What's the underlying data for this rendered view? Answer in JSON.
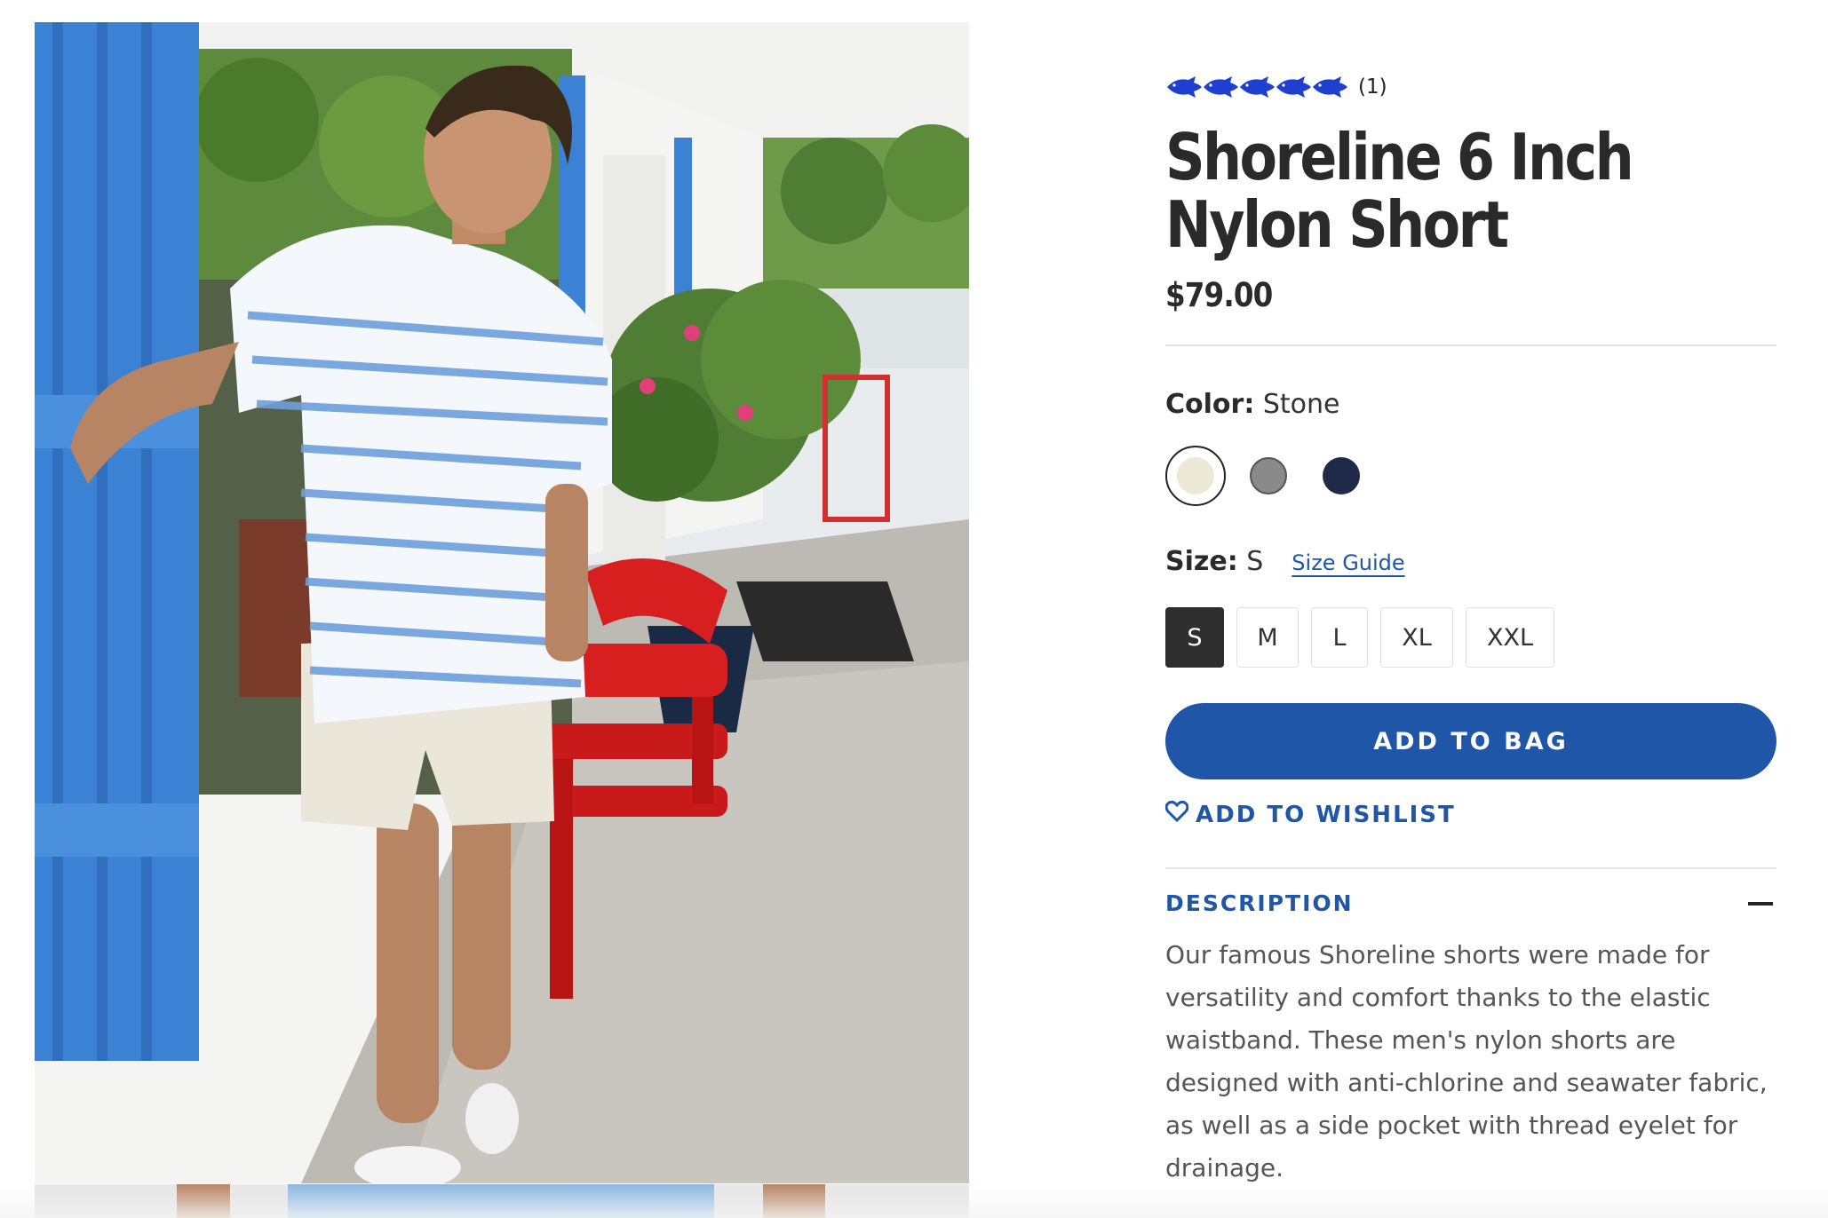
{
  "product": {
    "image_alt": "Man in striped button-down shirt and stone shorts leaning on blue shutter",
    "review_count": "(1)",
    "rating_icon": "fish-icon",
    "rating_color": "#1f3fd1",
    "title": "Shoreline 6 Inch Nylon Short",
    "price": "$79.00"
  },
  "color": {
    "label": "Color:",
    "selected": "Stone",
    "swatches": [
      {
        "name": "Stone",
        "hex": "#ece9d7"
      },
      {
        "name": "Gray",
        "hex": "#8a8a8a"
      },
      {
        "name": "Navy",
        "hex": "#1f2a4b"
      }
    ]
  },
  "size": {
    "label": "Size:",
    "selected": "S",
    "guide_link": "Size Guide",
    "options": [
      "S",
      "M",
      "L",
      "XL",
      "XXL"
    ]
  },
  "actions": {
    "add_to_bag": "ADD TO BAG",
    "add_to_wishlist": "ADD TO WISHLIST"
  },
  "description": {
    "heading": "DESCRIPTION",
    "body_lines": [
      "Our famous Shoreline shorts were made for",
      "versatility and comfort thanks to the elastic",
      "waistband. These men's nylon shorts are",
      "designed with anti-chlorine and seawater fabric,",
      "as well as a side pocket with thread eyelet for",
      "drainage."
    ]
  },
  "colors": {
    "accent": "#1f56a8",
    "text_dark": "#2a2a2a"
  }
}
